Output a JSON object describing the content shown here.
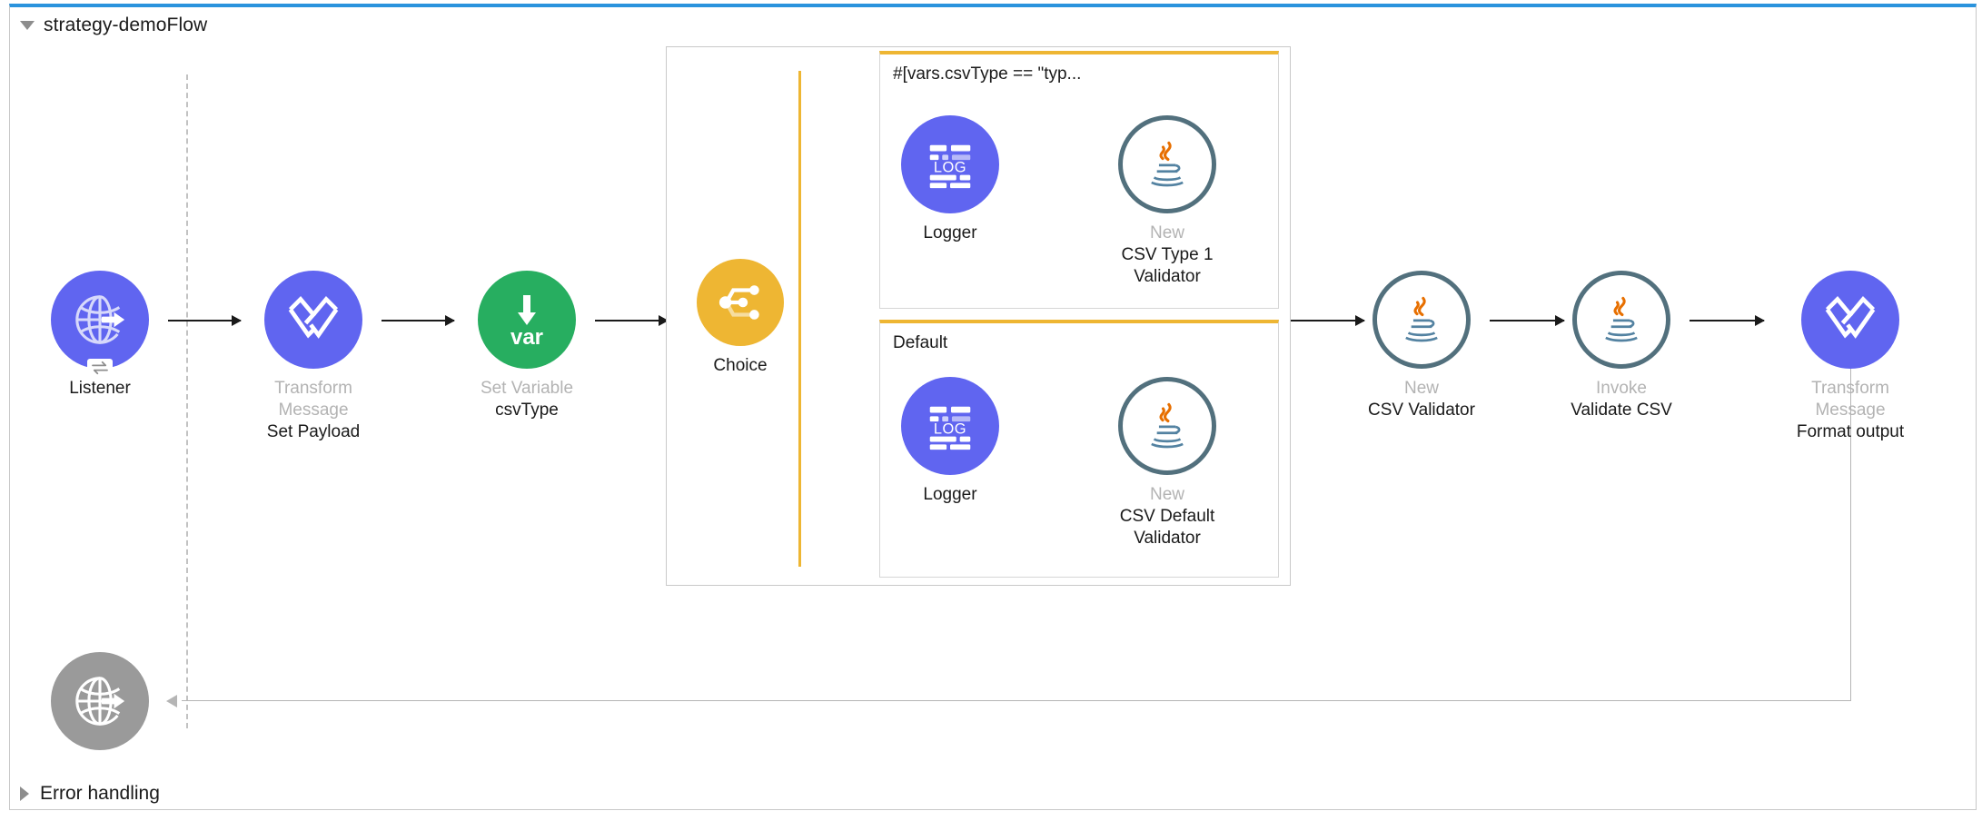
{
  "flow": {
    "title": "strategy-demoFlow",
    "expanded_icon": "triangle-down-icon",
    "error_handling_label": "Error handling",
    "error_handling_icon": "triangle-right-icon",
    "accent_top_border": "#2a93dd"
  },
  "colors": {
    "purple": "#6065f0",
    "green": "#27ae60",
    "amber": "#eeb633",
    "gray": "#9a9a9a",
    "java_ring": "#52707d",
    "java_steam": "#e76f00",
    "java_cup": "#5382a1",
    "muted_text": "#b3b3b3",
    "text": "#1a1a1a"
  },
  "nodes": {
    "listener": {
      "icon": "http-listener-globe-icon",
      "badge_icon": "exchange-arrows-icon",
      "type_label": "",
      "name_label": "Listener"
    },
    "transform_set_payload": {
      "icon": "transform-message-icon",
      "type_label": "Transform Message",
      "name_label": "Set Payload"
    },
    "set_variable": {
      "icon": "set-variable-var-icon",
      "type_label": "Set Variable",
      "name_label": "csvType"
    },
    "choice": {
      "icon": "choice-router-icon",
      "type_label": "",
      "name_label": "Choice"
    },
    "logger_type1": {
      "icon": "logger-icon",
      "type_label": "",
      "name_label": "Logger"
    },
    "csv_type1_validator": {
      "icon": "java-icon",
      "type_label": "New",
      "name_label": "CSV Type 1 Validator"
    },
    "logger_default": {
      "icon": "logger-icon",
      "type_label": "",
      "name_label": "Logger"
    },
    "csv_default_validator": {
      "icon": "java-icon",
      "type_label": "New",
      "name_label": "CSV Default Validator"
    },
    "csv_validator": {
      "icon": "java-icon",
      "type_label": "New",
      "name_label": "CSV Validator"
    },
    "validate_csv": {
      "icon": "java-icon",
      "type_label": "Invoke",
      "name_label": "Validate CSV"
    },
    "format_output": {
      "icon": "transform-message-icon",
      "type_label": "Transform Message",
      "name_label": "Format output"
    },
    "response": {
      "icon": "http-response-globe-icon",
      "type_label": "",
      "name_label": ""
    }
  },
  "branches": [
    {
      "label": "#[vars.csvType == \"typ..."
    },
    {
      "label": "Default"
    }
  ]
}
